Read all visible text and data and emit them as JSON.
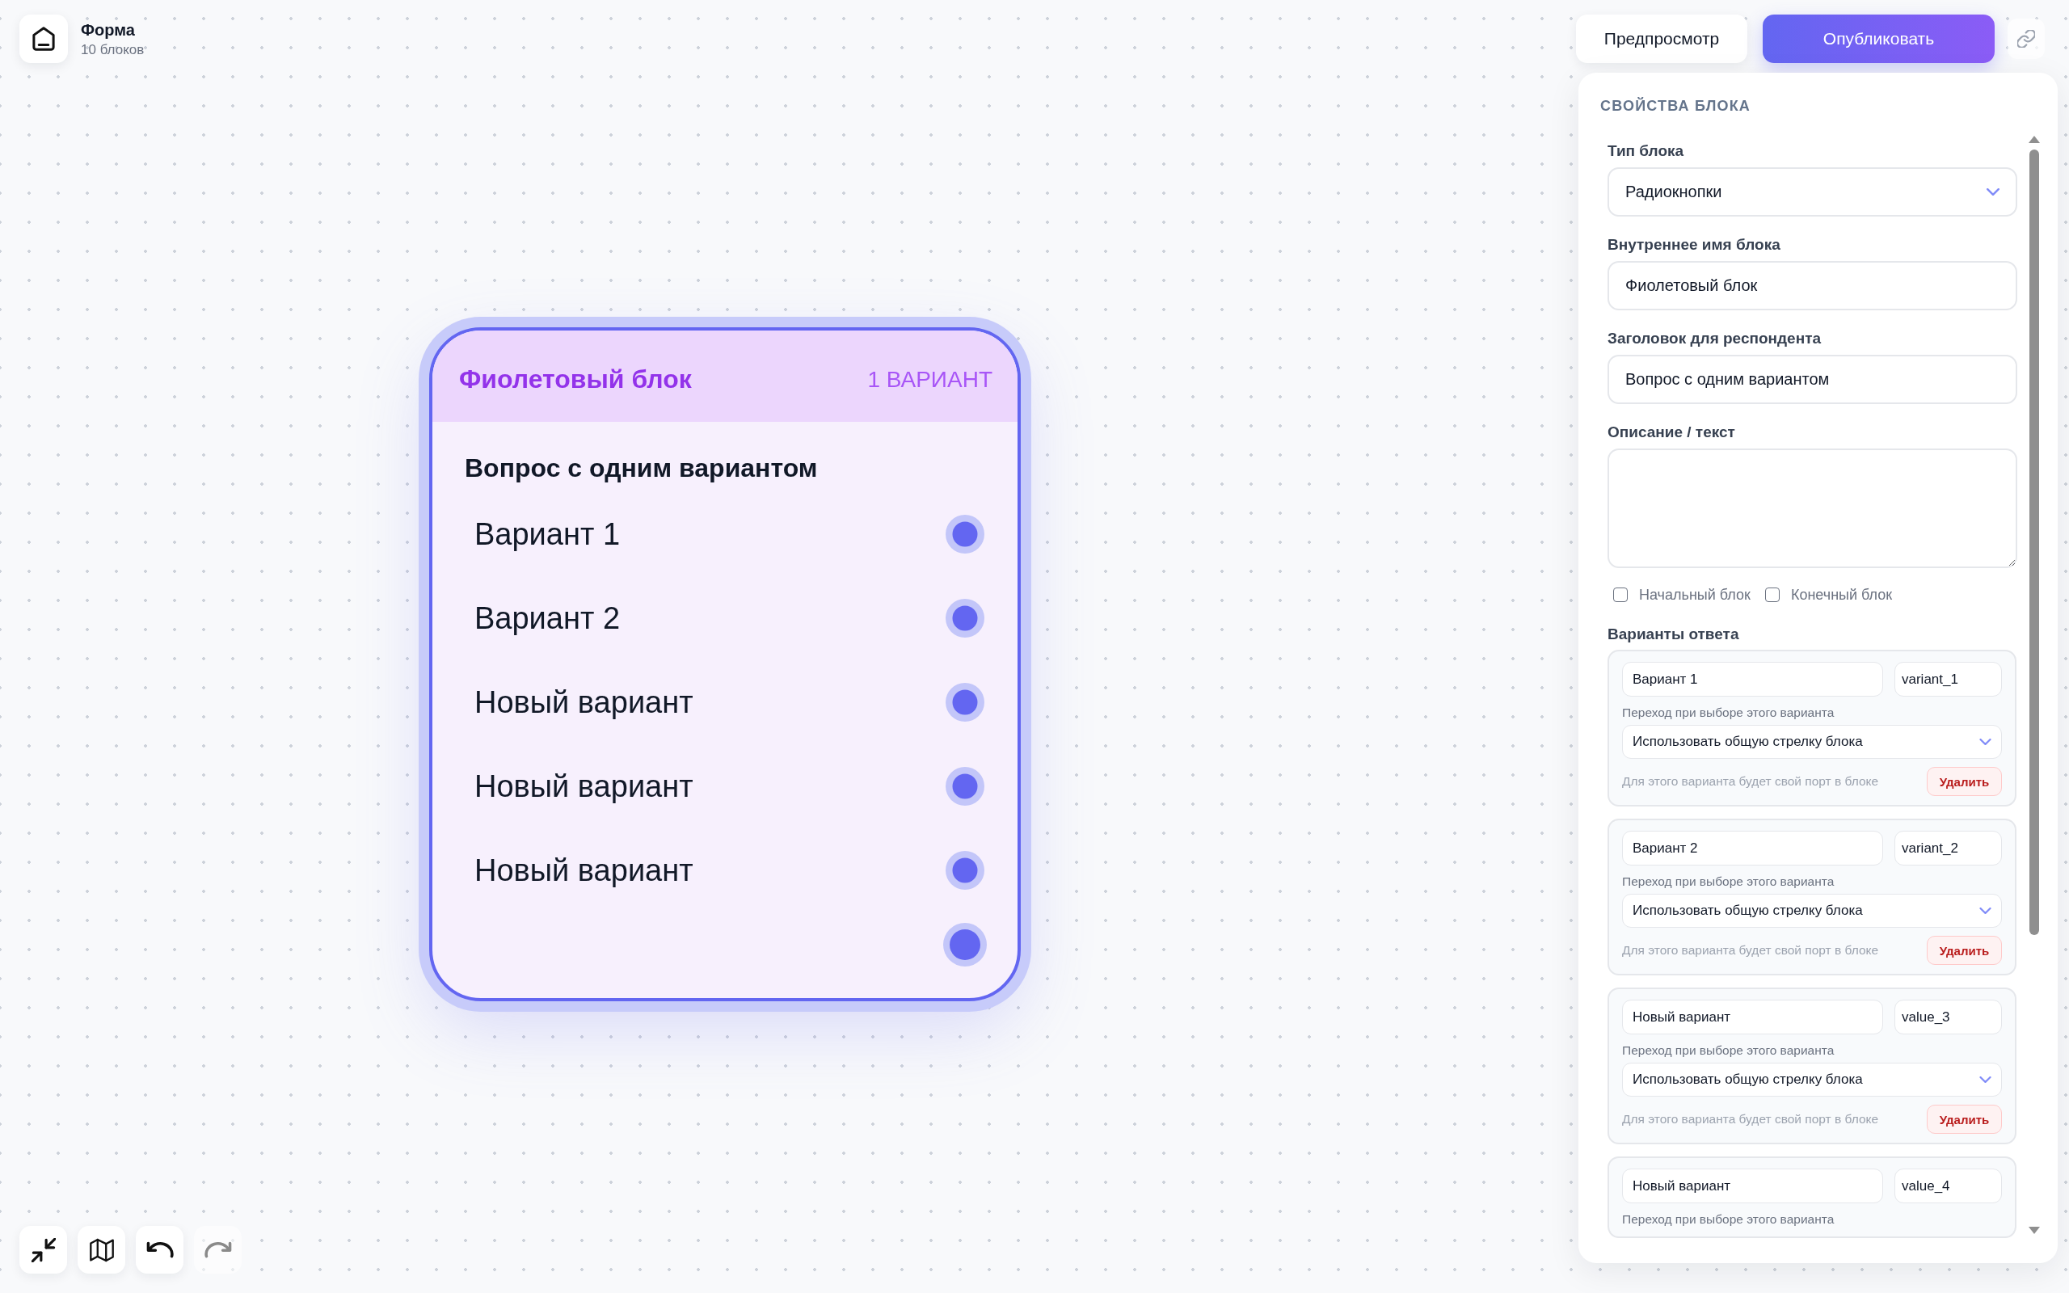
{
  "header": {
    "title": "Форма",
    "subtitle": "10 блоков"
  },
  "actions": [
    {
      "label": "Предпросмотр",
      "kind": "secondary"
    },
    {
      "label": "Опубликовать",
      "kind": "primary"
    }
  ],
  "block": {
    "selected": true,
    "title": "Фиолетовый блок",
    "badge": "1 ВАРИАНТ",
    "question": "Вопрос с одним вариантом",
    "options": [
      {
        "label": "Вариант 1"
      },
      {
        "label": "Вариант 2"
      },
      {
        "label": "Новый вариант"
      },
      {
        "label": "Новый вариант"
      },
      {
        "label": "Новый вариант"
      }
    ]
  },
  "canvas_controls": [
    {
      "kind": "fit",
      "disabled": false
    },
    {
      "kind": "map",
      "disabled": false
    },
    {
      "kind": "undo",
      "disabled": false
    },
    {
      "kind": "redo",
      "disabled": true
    }
  ],
  "panel": {
    "title": "СВОЙСТВА БЛОКА",
    "fields": [
      {
        "kind": "select",
        "label": "Тип блока",
        "value": "Радиокнопки"
      },
      {
        "kind": "input",
        "label": "Внутреннее имя блока",
        "value": "Фиолетовый блок"
      },
      {
        "kind": "input",
        "label": "Заголовок для респондента",
        "value": "Вопрос с одним вариантом"
      },
      {
        "kind": "textarea",
        "label": "Описание / текст"
      }
    ],
    "checkboxes": [
      {
        "label": "Начальный блок",
        "checked": false
      },
      {
        "label": "Конечный блок",
        "checked": false
      }
    ],
    "variants_label": "Варианты ответа",
    "variants": [
      {
        "label": "Вариант 1",
        "value": "variant_1",
        "transition_label": "Переход при выборе этого варианта",
        "transition": "Использовать общую стрелку блока",
        "hint": "Для этого варианта будет свой порт в блоке",
        "delete": "Удалить"
      },
      {
        "label": "Вариант 2",
        "value": "variant_2",
        "transition_label": "Переход при выборе этого варианта",
        "transition": "Использовать общую стрелку блока",
        "hint": "Для этого варианта будет свой порт в блоке",
        "delete": "Удалить"
      },
      {
        "label": "Новый вариант",
        "value": "value_3",
        "transition_label": "Переход при выборе этого варианта",
        "transition": "Использовать общую стрелку блока",
        "hint": "Для этого варианта будет свой порт в блоке",
        "delete": "Удалить"
      },
      {
        "label": "Новый вариант",
        "value": "value_4",
        "transition_label": "Переход при выборе этого варианта"
      }
    ]
  }
}
